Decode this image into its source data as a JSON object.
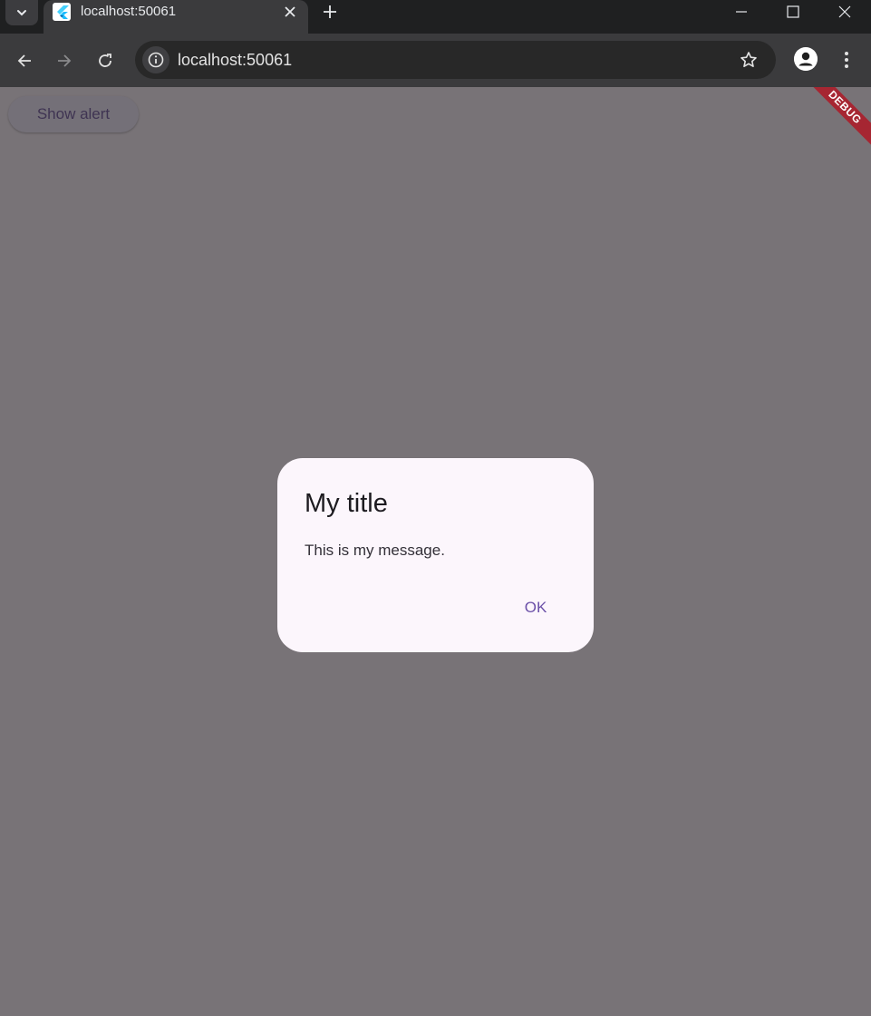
{
  "browser": {
    "tab": {
      "title": "localhost:50061"
    },
    "omnibox": {
      "url": "localhost:50061"
    }
  },
  "page": {
    "show_alert_label": "Show alert",
    "debug_banner_label": "DEBUG",
    "background_color": "#787377"
  },
  "dialog": {
    "title": "My title",
    "message": "This is my message.",
    "ok_label": "OK",
    "background_color": "#fcf6fc",
    "accent_color": "#6b50a8"
  }
}
